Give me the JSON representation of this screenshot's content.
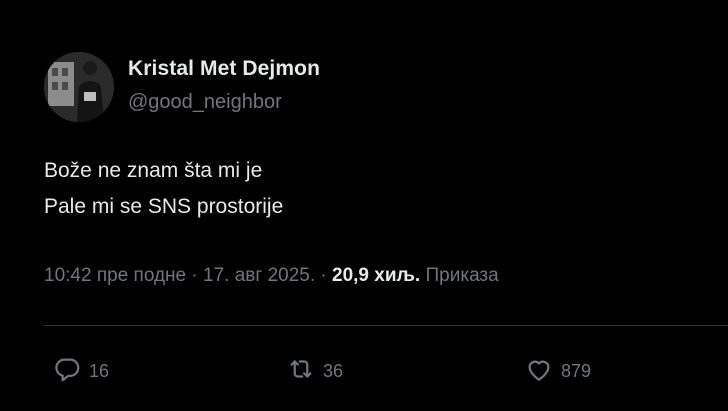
{
  "author": {
    "name": "Kristal Met Dejmon",
    "handle": "@good_neighbor"
  },
  "tweet": {
    "lines": [
      "Bože ne znam šta mi je",
      "Pale mi se SNS prostorije"
    ]
  },
  "meta": {
    "time": "10:42 пре подне",
    "sep1": " · ",
    "date": "17. авг 2025.",
    "sep2": " · ",
    "views_count": "20,9 хиљ.",
    "views_label": " Приказа"
  },
  "actions": {
    "replies": "16",
    "reposts": "36",
    "likes": "879"
  },
  "icons": {
    "reply": "reply-icon",
    "repost": "repost-icon",
    "like": "heart-icon"
  },
  "colors": {
    "background": "#000000",
    "text": "#e7e9ea",
    "secondary": "#71767b",
    "divider": "#2f3336"
  }
}
